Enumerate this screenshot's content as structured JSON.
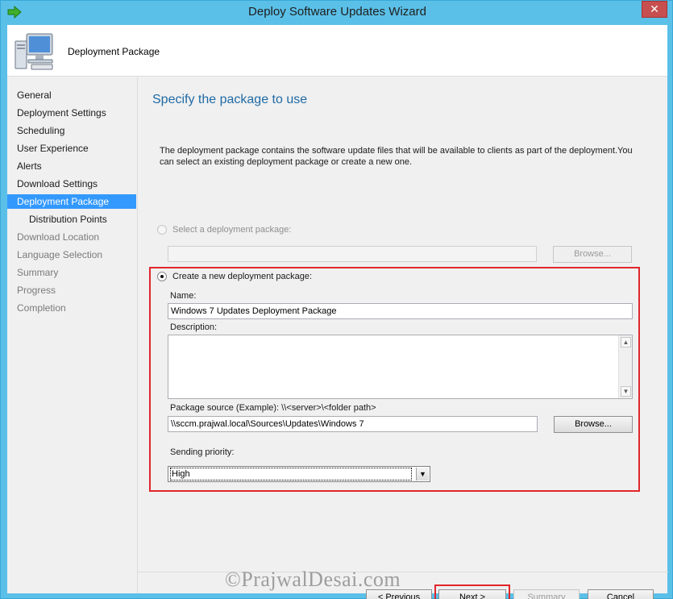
{
  "window": {
    "title": "Deploy Software Updates Wizard",
    "close_glyph": "✕"
  },
  "header": {
    "title": "Deployment Package"
  },
  "nav": {
    "items": [
      {
        "label": "General",
        "state": "normal"
      },
      {
        "label": "Deployment Settings",
        "state": "normal"
      },
      {
        "label": "Scheduling",
        "state": "normal"
      },
      {
        "label": "User Experience",
        "state": "normal"
      },
      {
        "label": "Alerts",
        "state": "normal"
      },
      {
        "label": "Download Settings",
        "state": "normal"
      },
      {
        "label": "Deployment Package",
        "state": "active"
      },
      {
        "label": "Distribution Points",
        "state": "normal"
      },
      {
        "label": "Download Location",
        "state": "disabled"
      },
      {
        "label": "Language Selection",
        "state": "disabled"
      },
      {
        "label": "Summary",
        "state": "disabled"
      },
      {
        "label": "Progress",
        "state": "disabled"
      },
      {
        "label": "Completion",
        "state": "disabled"
      }
    ]
  },
  "content": {
    "page_title": "Specify the package to use",
    "description": "The deployment package contains the software update files that will be available to clients as part of the deployment.You can select an existing deployment package or create a new one.",
    "select_existing": {
      "label": "Select a deployment package:",
      "checked": false,
      "enabled": false,
      "value": "",
      "browse_label": "Browse..."
    },
    "create_new": {
      "label": "Create a new deployment package:",
      "checked": true,
      "name_label": "Name:",
      "name_value": "Windows 7 Updates Deployment Package",
      "description_label": "Description:",
      "description_value": "",
      "source_label": "Package source (Example): \\\\<server>\\<folder path>",
      "source_value": "\\\\sccm.prajwal.local\\Sources\\Updates\\Windows 7",
      "browse_label": "Browse...",
      "priority_label": "Sending priority:",
      "priority_value": "High"
    }
  },
  "footer": {
    "previous_label": "< Previous",
    "next_label": "Next >",
    "summary_label": "Summary",
    "cancel_label": "Cancel"
  },
  "watermark": "©PrajwalDesai.com",
  "colors": {
    "accent": "#1e6aa5",
    "highlight": "#e0262c",
    "selection": "#3399ff",
    "frame": "#5bc0e8"
  }
}
